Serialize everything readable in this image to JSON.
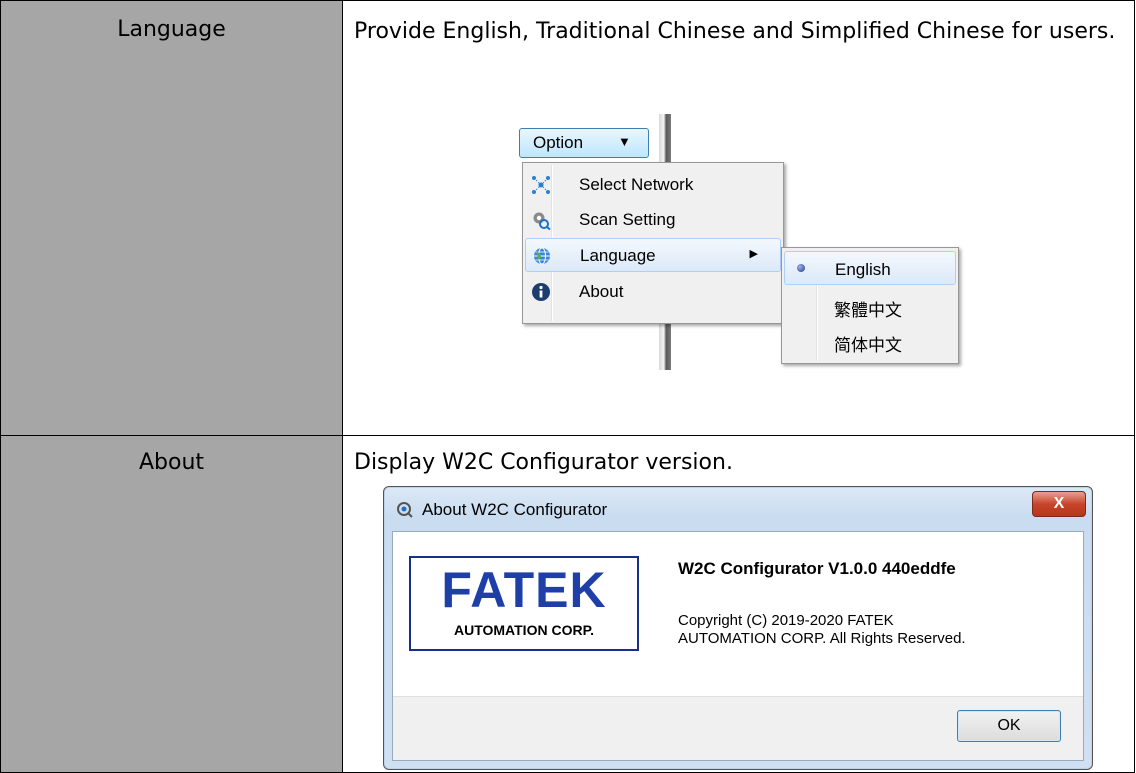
{
  "rows": [
    {
      "label": "Language",
      "description": "Provide English, Traditional Chinese and Simplified Chinese for users."
    },
    {
      "label": "About",
      "description": "Display W2C Configurator version."
    }
  ],
  "option_menu": {
    "button_label": "Option",
    "button_arrow": "▼",
    "items": [
      {
        "label": "Select Network",
        "icon": "network-icon"
      },
      {
        "label": "Scan Setting",
        "icon": "scan-setting-icon"
      },
      {
        "label": "Language",
        "icon": "globe-icon",
        "submenu_arrow": "▶"
      },
      {
        "label": "About",
        "icon": "info-icon"
      }
    ],
    "language_submenu": [
      {
        "label": "English",
        "selected": true
      },
      {
        "label": "繁體中文",
        "selected": false
      },
      {
        "label": "简体中文",
        "selected": false
      }
    ]
  },
  "about_dialog": {
    "title": "About W2C Configurator",
    "close_label": "X",
    "logo_text": "FATEK",
    "logo_subtext": "AUTOMATION CORP.",
    "version": "W2C Configurator V1.0.0 440eddfe",
    "copyright_line1": "Copyright (C) 2019-2020 FATEK",
    "copyright_line2": "AUTOMATION CORP. All Rights Reserved.",
    "ok_label": "OK"
  },
  "colors": {
    "label_cell_bg": "#a6a6a6",
    "logo_blue": "#1e3fa8",
    "close_red": "#c8452c"
  }
}
